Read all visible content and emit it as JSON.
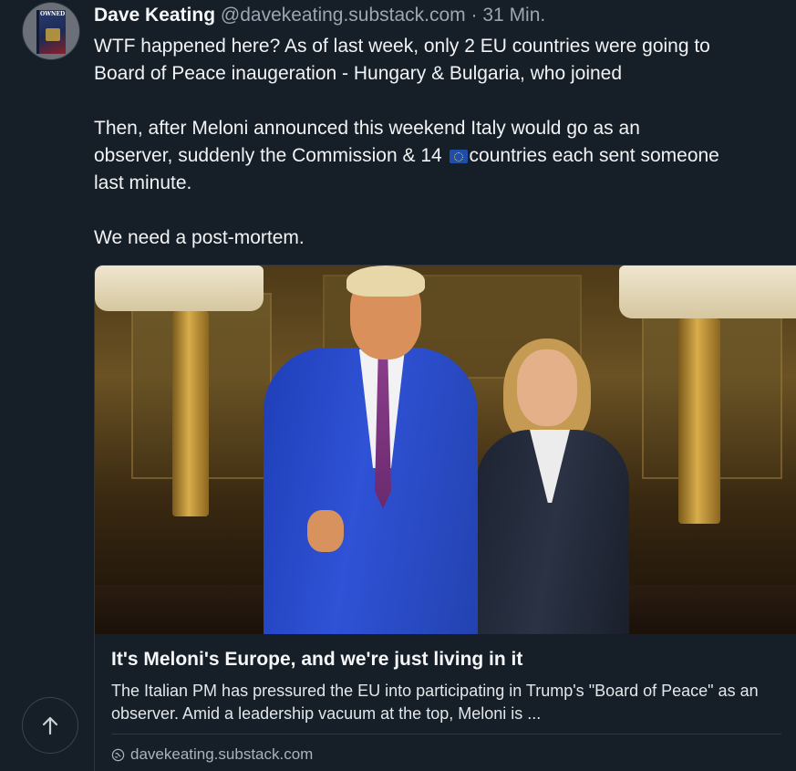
{
  "post": {
    "author": {
      "name": "Dave Keating",
      "handle": "@davekeating.substack.com",
      "separator": "·",
      "time": "31 Min.",
      "avatar_book_text": "OWNED"
    },
    "text": {
      "line1": "WTF happened here? As of last week, only 2 EU countries were going to",
      "line2": "Board of Peace inaugeration - Hungary & Bulgaria, who joined",
      "line3": "Then, after Meloni announced this weekend Italy would go as an",
      "line4_before_flag": "observer, suddenly the Commission & 14 ",
      "line4_after_flag": "countries each sent someone",
      "line5": "last minute.",
      "line6": "We need a post-mortem."
    },
    "link_card": {
      "title": "It's Meloni's Europe, and we're just living in it",
      "description": "The Italian PM has pressured the EU into participating in Trump's \"Board of Peace\" as an observer. Amid a leadership vacuum at the top, Meloni is ...",
      "domain": "davekeating.substack.com",
      "domain_icon": "globe-icon"
    }
  },
  "controls": {
    "scroll_top_icon": "arrow-up-icon"
  },
  "colors": {
    "background": "#161e27",
    "text": "#f1f3f5",
    "muted": "#9ba6b2",
    "eu_flag_blue": "#1f4ea8"
  }
}
